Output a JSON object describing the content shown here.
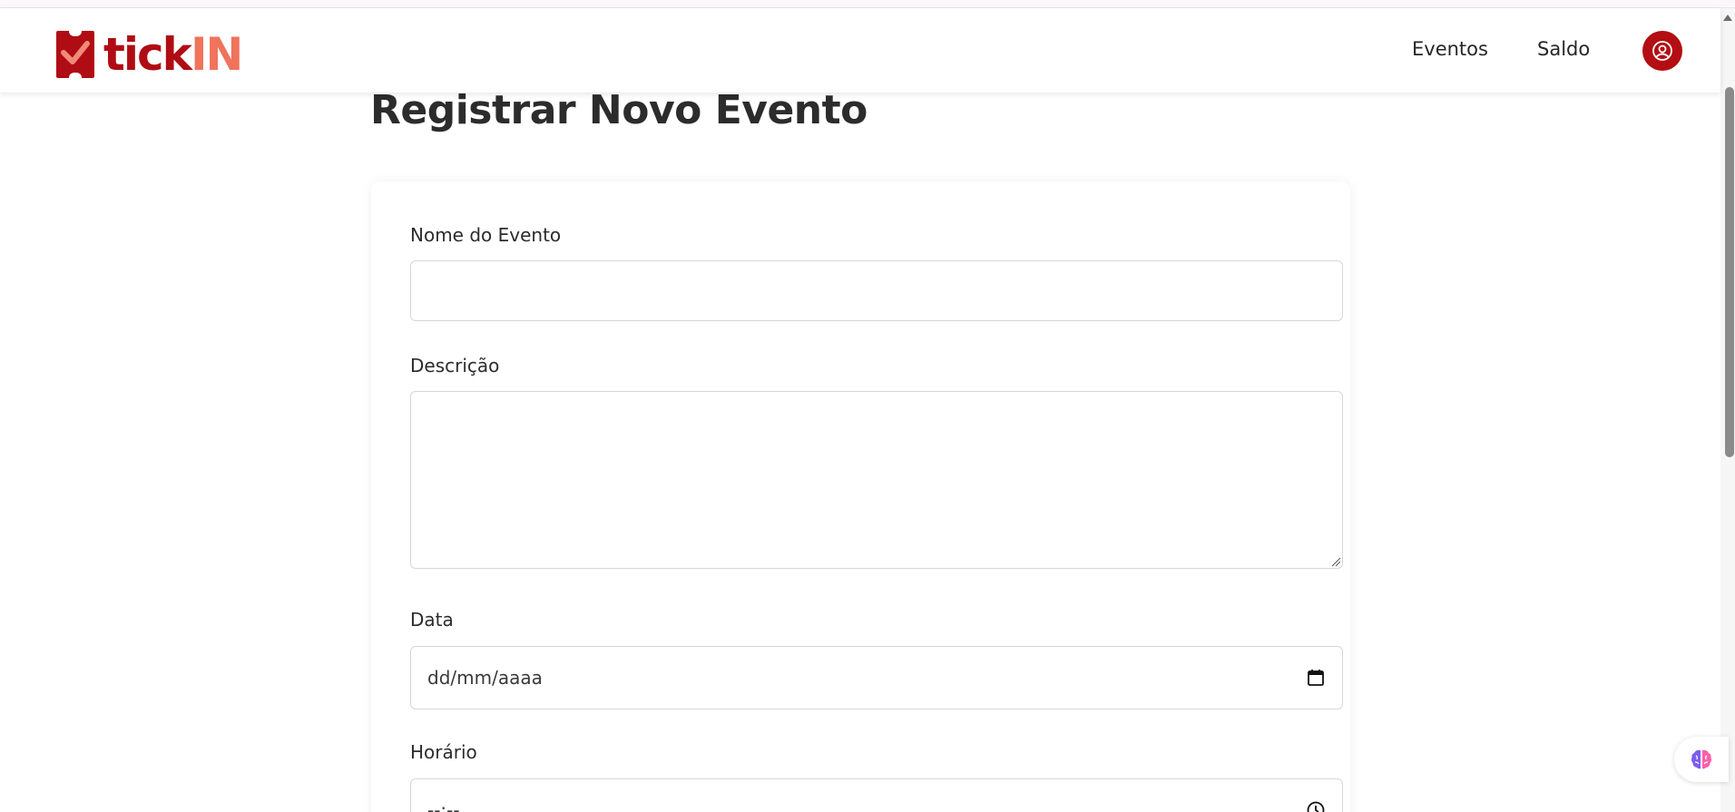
{
  "brand": {
    "logo_text_part1": "tick",
    "logo_text_part2": "IN",
    "primary_color": "#b00c14",
    "accent_color": "#f0735b"
  },
  "nav": {
    "links": [
      {
        "label": "Eventos"
      },
      {
        "label": "Saldo"
      }
    ],
    "avatar_icon": "user-circle-icon"
  },
  "page": {
    "title": "Registrar Novo Evento"
  },
  "form": {
    "nome": {
      "label": "Nome do Evento",
      "value": ""
    },
    "descricao": {
      "label": "Descrição",
      "value": ""
    },
    "data": {
      "label": "Data",
      "placeholder": "dd/mm/aaaa",
      "icon": "calendar-icon"
    },
    "horario": {
      "label": "Horário",
      "placeholder": "--:--",
      "icon": "clock-icon"
    }
  },
  "floating_widget": {
    "icon": "brain-icon"
  }
}
